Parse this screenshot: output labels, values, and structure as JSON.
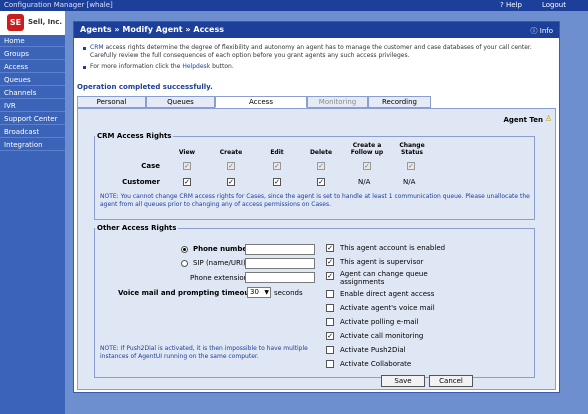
{
  "topbar": {
    "title": "Configuration Manager [whale]",
    "help": "? Help",
    "logout": "Logout"
  },
  "sidebar": {
    "logo_mark": "SE",
    "logo_name": "Sell, Inc.",
    "items": [
      "Home",
      "Groups",
      "Access",
      "Queues",
      "Channels",
      "IVR",
      "Support Center",
      "Broadcast",
      "Integration"
    ]
  },
  "page": {
    "heading": "Agents » Modify Agent » Access",
    "info": "Info",
    "intro_link": "CRM",
    "intro_1": "access rights determine the degree of flexibility and autonomy an agent has to manage the customer and case databases of your call",
    "intro_2": "center. Carefully review the full consequences of each option before you grant agents any such access privileges.",
    "intro_3_a": "For more information click the",
    "intro_3_link": "Helpdesk",
    "intro_3_b": "button.",
    "status": "Operation completed successfully.",
    "tabs": [
      {
        "label": "Personal",
        "state": "normal"
      },
      {
        "label": "Queues",
        "state": "normal"
      },
      {
        "label": "Access",
        "state": "active"
      },
      {
        "label": "Monitoring",
        "state": "disabled"
      },
      {
        "label": "Recording",
        "state": "normal"
      }
    ],
    "agent_name": "Agent Ten"
  },
  "crm": {
    "legend": "CRM Access Rights",
    "columns": [
      "View",
      "Create",
      "Edit",
      "Delete",
      "Create a Follow up",
      "Change Status"
    ],
    "rows": [
      {
        "label": "Case",
        "checks": [
          true,
          true,
          true,
          true,
          true,
          true
        ],
        "disabled": true
      },
      {
        "label": "Customer",
        "checks": [
          true,
          true,
          true,
          true
        ],
        "na": [
          "N/A",
          "N/A"
        ]
      }
    ],
    "note": "NOTE: You cannot change CRM access rights for Cases, since the agent is set to handle at least 1 communication queue. Please unallocate the agent from all queues prior to changing any of access permissions on Cases."
  },
  "other": {
    "legend": "Other Access Rights",
    "phone_number_label": "Phone number:",
    "phone_number_value": "",
    "sip_label": "SIP (name/URI):",
    "sip_value": "",
    "ext_label": "Phone extension:",
    "ext_value": "",
    "voicemail_label": "Voice mail and prompting timeout:",
    "voicemail_value": "30",
    "voicemail_unit": "seconds",
    "note": "NOTE: If Push2Dial is activated, it is then impossible to have multiple instances of AgentUI running on the same computer.",
    "options": [
      {
        "label": "This agent account is enabled",
        "checked": true
      },
      {
        "label": "This agent is supervisor",
        "checked": true
      },
      {
        "label": "Agent can change queue assignments",
        "checked": true
      },
      {
        "label": "Enable direct agent access",
        "checked": false
      },
      {
        "label": "Activate agent's voice mail",
        "checked": false
      },
      {
        "label": "Activate polling e-mail",
        "checked": false
      },
      {
        "label": "Activate call monitoring",
        "checked": true
      },
      {
        "label": "Activate Push2Dial",
        "checked": false
      },
      {
        "label": "Activate Collaborate",
        "checked": false
      }
    ]
  },
  "buttons": {
    "save": "Save",
    "cancel": "Cancel"
  },
  "colors": {
    "header_blue": "#1c3f9a",
    "sidebar_blue": "#3b64b8",
    "background_blue": "#6e8fcf",
    "tab_body": "#dfe6f4"
  }
}
